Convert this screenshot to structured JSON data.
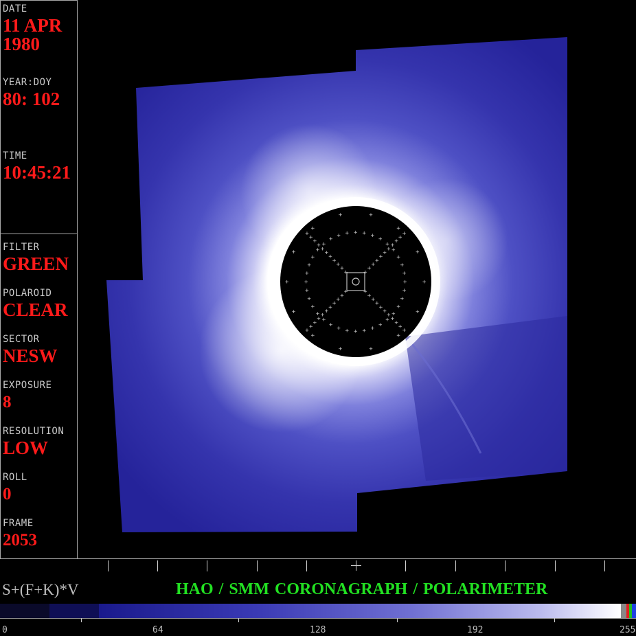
{
  "sidebar": {
    "date_label": "DATE",
    "date_day_month": "11 APR",
    "date_year": "1980",
    "year_doy_label": "YEAR:DOY",
    "year_doy_value": "80: 102",
    "time_label": "TIME",
    "time_value": "10:45:21",
    "filter_label": "FILTER",
    "filter_value": "GREEN",
    "polaroid_label": "POLAROID",
    "polaroid_value": "CLEAR",
    "sector_label": "SECTOR",
    "sector_value": "NESW",
    "exposure_label": "EXPOSURE",
    "exposure_value": "8",
    "resolution_label": "RESOLUTION",
    "resolution_value": "LOW",
    "roll_label": "ROLL",
    "roll_value": "0",
    "frame_label": "FRAME",
    "frame_value": "2053"
  },
  "footer": {
    "formula": "S+(F+K)*V",
    "title": "HAO / SMM   CORONAGRAPH / POLARIMETER",
    "scale_labels": [
      "0",
      "64",
      "128",
      "192",
      "255"
    ]
  },
  "colors": {
    "corona_dark": "#1e1c8c",
    "corona_mid": "#4f50c6",
    "corona_bright": "#ffffff",
    "label_red": "#ff1a1a",
    "title_green": "#22e022"
  }
}
